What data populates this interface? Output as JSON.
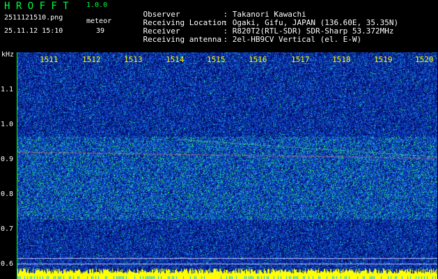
{
  "header": {
    "title_letters": "H R O F F T",
    "version": "1.0.0",
    "filename": "2511121510.png",
    "datetime": "25.11.12 15:10",
    "meteor_label": "meteor",
    "meteor_count": "39"
  },
  "info": [
    {
      "key": "Observer",
      "value": ": Takanori Kawachi"
    },
    {
      "key": "Receiving Location",
      "value": ": Ogaki, Gifu, JAPAN (136.60E, 35.35N)"
    },
    {
      "key": "Receiver",
      "value": ": R820T2(RTL-SDR) SDR-Sharp 53.372MHz"
    },
    {
      "key": "Receiving antenna",
      "value": ": 2el-HB9CV Vertical (el. E-W)"
    }
  ],
  "axis": {
    "y_unit": "kHz",
    "y_ticks": [
      "1.1",
      "1.0",
      "0.9",
      "0.8",
      "0.7",
      "0.6"
    ],
    "x_ticks": [
      "1511",
      "1512",
      "1513",
      "1514",
      "1515",
      "1516",
      "1517",
      "1518",
      "1519",
      "1520"
    ]
  },
  "colors": {
    "label_green": "#00ff40",
    "tick_yellow": "#ffff00",
    "background": "#000000"
  }
}
